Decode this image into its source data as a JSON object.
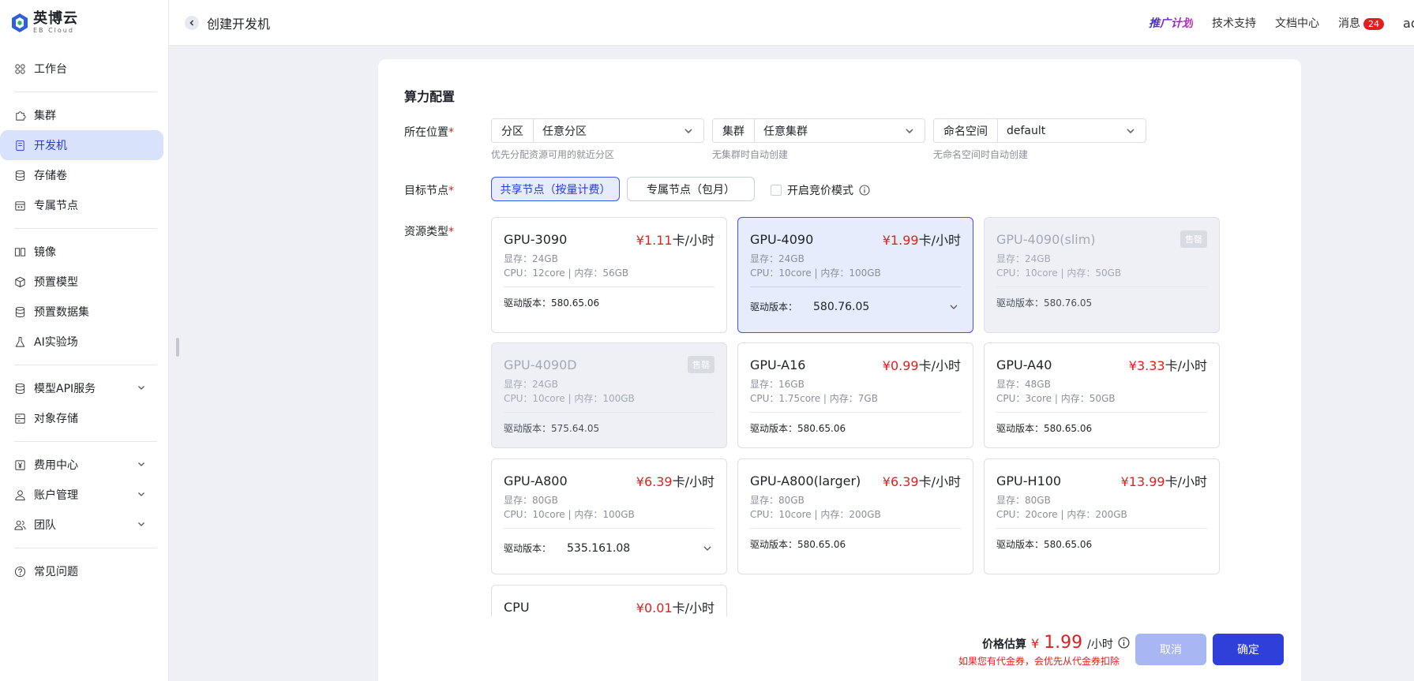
{
  "brand": {
    "name_cn": "英博云",
    "name_en": "EB Cloud"
  },
  "sidebar": {
    "items": [
      {
        "key": "workbench",
        "label": "工作台",
        "icon": "grid-icon"
      },
      {
        "key": "cluster",
        "label": "集群",
        "icon": "puzzle-icon"
      },
      {
        "key": "devmachine",
        "label": "开发机",
        "icon": "server-icon",
        "active": true
      },
      {
        "key": "storage",
        "label": "存储卷",
        "icon": "database-icon"
      },
      {
        "key": "dedicated",
        "label": "专属节点",
        "icon": "calendar-icon"
      },
      {
        "key": "image",
        "label": "镜像",
        "icon": "book-icon"
      },
      {
        "key": "premodel",
        "label": "预置模型",
        "icon": "cube-icon"
      },
      {
        "key": "predataset",
        "label": "预置数据集",
        "icon": "database-icon"
      },
      {
        "key": "ailab",
        "label": "AI实验场",
        "icon": "flask-icon"
      },
      {
        "key": "modelapi",
        "label": "模型API服务",
        "icon": "database-icon",
        "expandable": true
      },
      {
        "key": "oss",
        "label": "对象存储",
        "icon": "storage-box-icon"
      },
      {
        "key": "billing",
        "label": "费用中心",
        "icon": "yen-icon",
        "expandable": true
      },
      {
        "key": "account",
        "label": "账户管理",
        "icon": "user-icon",
        "expandable": true
      },
      {
        "key": "team",
        "label": "团队",
        "icon": "team-icon",
        "expandable": true
      },
      {
        "key": "faq",
        "label": "常见问题",
        "icon": "help-icon"
      }
    ]
  },
  "header": {
    "title": "创建开发机",
    "promo": "推广计划",
    "support": "技术支持",
    "docs": "文档中心",
    "messages": "消息",
    "message_count": "24",
    "user_cut": "ad"
  },
  "form": {
    "section_title": "算力配置",
    "location_label": "所在位置",
    "zone": {
      "prefix": "分区",
      "value": "任意分区",
      "hint": "优先分配资源可用的就近分区"
    },
    "cluster": {
      "prefix": "集群",
      "value": "任意集群",
      "hint": "无集群时自动创建"
    },
    "namespace": {
      "prefix": "命名空间",
      "value": "default",
      "hint": "无命名空间时自动创建"
    },
    "target_label": "目标节点",
    "shared_node": "共享节点（按量计费）",
    "dedicated_node": "专属节点（包月）",
    "bid_mode": "开启竞价模式",
    "resource_label": "资源类型",
    "required_mark": "*"
  },
  "gpus": [
    {
      "name": "GPU-3090",
      "price": "¥1.11",
      "unit": "卡/小时",
      "mem": "显存：24GB",
      "cpu": "CPU：12core | 内存：56GB",
      "driver_label": "驱动版本：",
      "driver": "580.65.06"
    },
    {
      "name": "GPU-4090",
      "price": "¥1.99",
      "unit": "卡/小时",
      "mem": "显存：24GB",
      "cpu": "CPU：10core | 内存：100GB",
      "driver_label": "驱动版本：",
      "driver": "580.76.05"
    },
    {
      "name": "GPU-4090(slim)",
      "sold": "售罄",
      "mem": "显存：24GB",
      "cpu": "CPU：10core | 内存：50GB",
      "driver_label": "驱动版本：",
      "driver": "580.76.05"
    },
    {
      "name": "GPU-4090D",
      "sold": "售罄",
      "mem": "显存：24GB",
      "cpu": "CPU：10core | 内存：100GB",
      "driver_label": "驱动版本：",
      "driver": "575.64.05"
    },
    {
      "name": "GPU-A16",
      "price": "¥0.99",
      "unit": "卡/小时",
      "mem": "显存：16GB",
      "cpu": "CPU：1.75core | 内存：7GB",
      "driver_label": "驱动版本：",
      "driver": "580.65.06"
    },
    {
      "name": "GPU-A40",
      "price": "¥3.33",
      "unit": "卡/小时",
      "mem": "显存：48GB",
      "cpu": "CPU：3core | 内存：50GB",
      "driver_label": "驱动版本：",
      "driver": "580.65.06"
    },
    {
      "name": "GPU-A800",
      "price": "¥6.39",
      "unit": "卡/小时",
      "mem": "显存：80GB",
      "cpu": "CPU：10core | 内存：100GB",
      "driver_label": "驱动版本：",
      "driver": "535.161.08"
    },
    {
      "name": "GPU-A800(larger)",
      "price": "¥6.39",
      "unit": "卡/小时",
      "mem": "显存：80GB",
      "cpu": "CPU：10core | 内存：200GB",
      "driver_label": "驱动版本：",
      "driver": "580.65.06"
    },
    {
      "name": "GPU-H100",
      "price": "¥13.99",
      "unit": "卡/小时",
      "mem": "显存：80GB",
      "cpu": "CPU：20core | 内存：200GB",
      "driver_label": "驱动版本：",
      "driver": "580.65.06"
    },
    {
      "name": "CPU",
      "price": "¥0.01",
      "unit": "卡/小时"
    }
  ],
  "footer": {
    "estimate_label": "价格估算",
    "currency": "¥",
    "amount": "1.99",
    "unit": "/小时",
    "note": "如果您有代金券，会优先从代金券扣除",
    "cancel": "取消",
    "confirm": "确定"
  },
  "colors": {
    "accent": "#2f3fd9",
    "price": "#e02020",
    "selected_bg": "#e6ecfc"
  }
}
